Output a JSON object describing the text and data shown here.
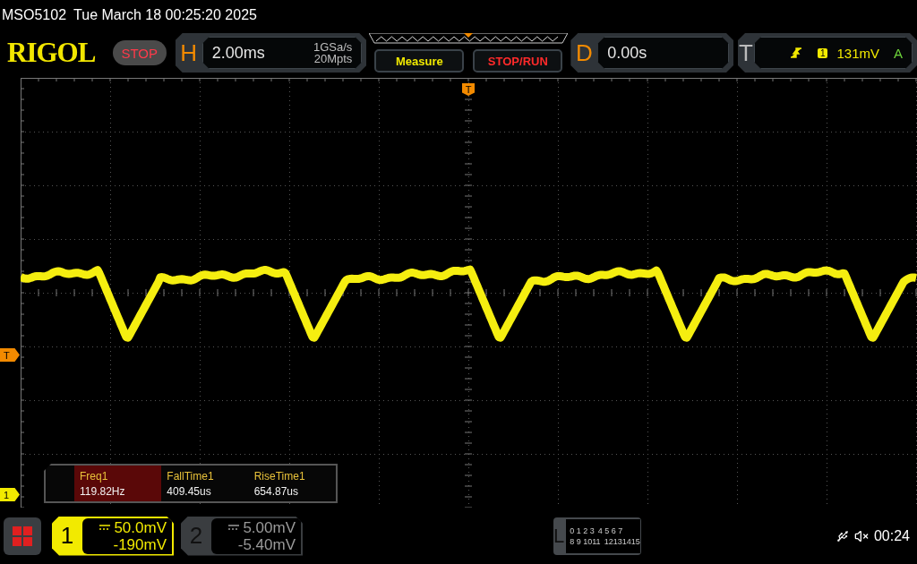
{
  "status_line": {
    "model": "MSO5102",
    "datetime": "Tue March 18 00:25:20 2025"
  },
  "logo": "RIGOL",
  "run_state": {
    "label": "STOP",
    "kind": "stop"
  },
  "horizontal": {
    "letter": "H",
    "timebase": "2.00ms",
    "sample_rate": "1GSa/s",
    "memory_depth": "20Mpts"
  },
  "buttons": [
    {
      "label": "Measure",
      "kind": "measure"
    },
    {
      "label": "STOP/RUN",
      "kind": "stoprun"
    }
  ],
  "delay": {
    "letter": "D",
    "value": "0.00s"
  },
  "trigger": {
    "letter": "T",
    "source": "1",
    "level": "131mV",
    "mode": "A"
  },
  "markers": {
    "trigger_position": "T",
    "trigger_level": "T",
    "channel_1": "1"
  },
  "measurements": [
    {
      "name": "Freq1",
      "value": "119.82Hz",
      "selected": true
    },
    {
      "name": "FallTime1",
      "value": "409.45us",
      "selected": false
    },
    {
      "name": "RiseTime1",
      "value": "654.87us",
      "selected": false
    }
  ],
  "channels": [
    {
      "number": "1",
      "scale": "50.0mV",
      "offset": "-190mV",
      "enabled": true
    },
    {
      "number": "2",
      "scale": "5.00mV",
      "offset": "-5.40mV",
      "enabled": false
    }
  ],
  "logic": {
    "letter": "L",
    "rows": [
      [
        "0 1 2 3",
        "4 5 6 7"
      ],
      [
        "8 9 1011",
        "12131415"
      ]
    ]
  },
  "clock": "00:24"
}
